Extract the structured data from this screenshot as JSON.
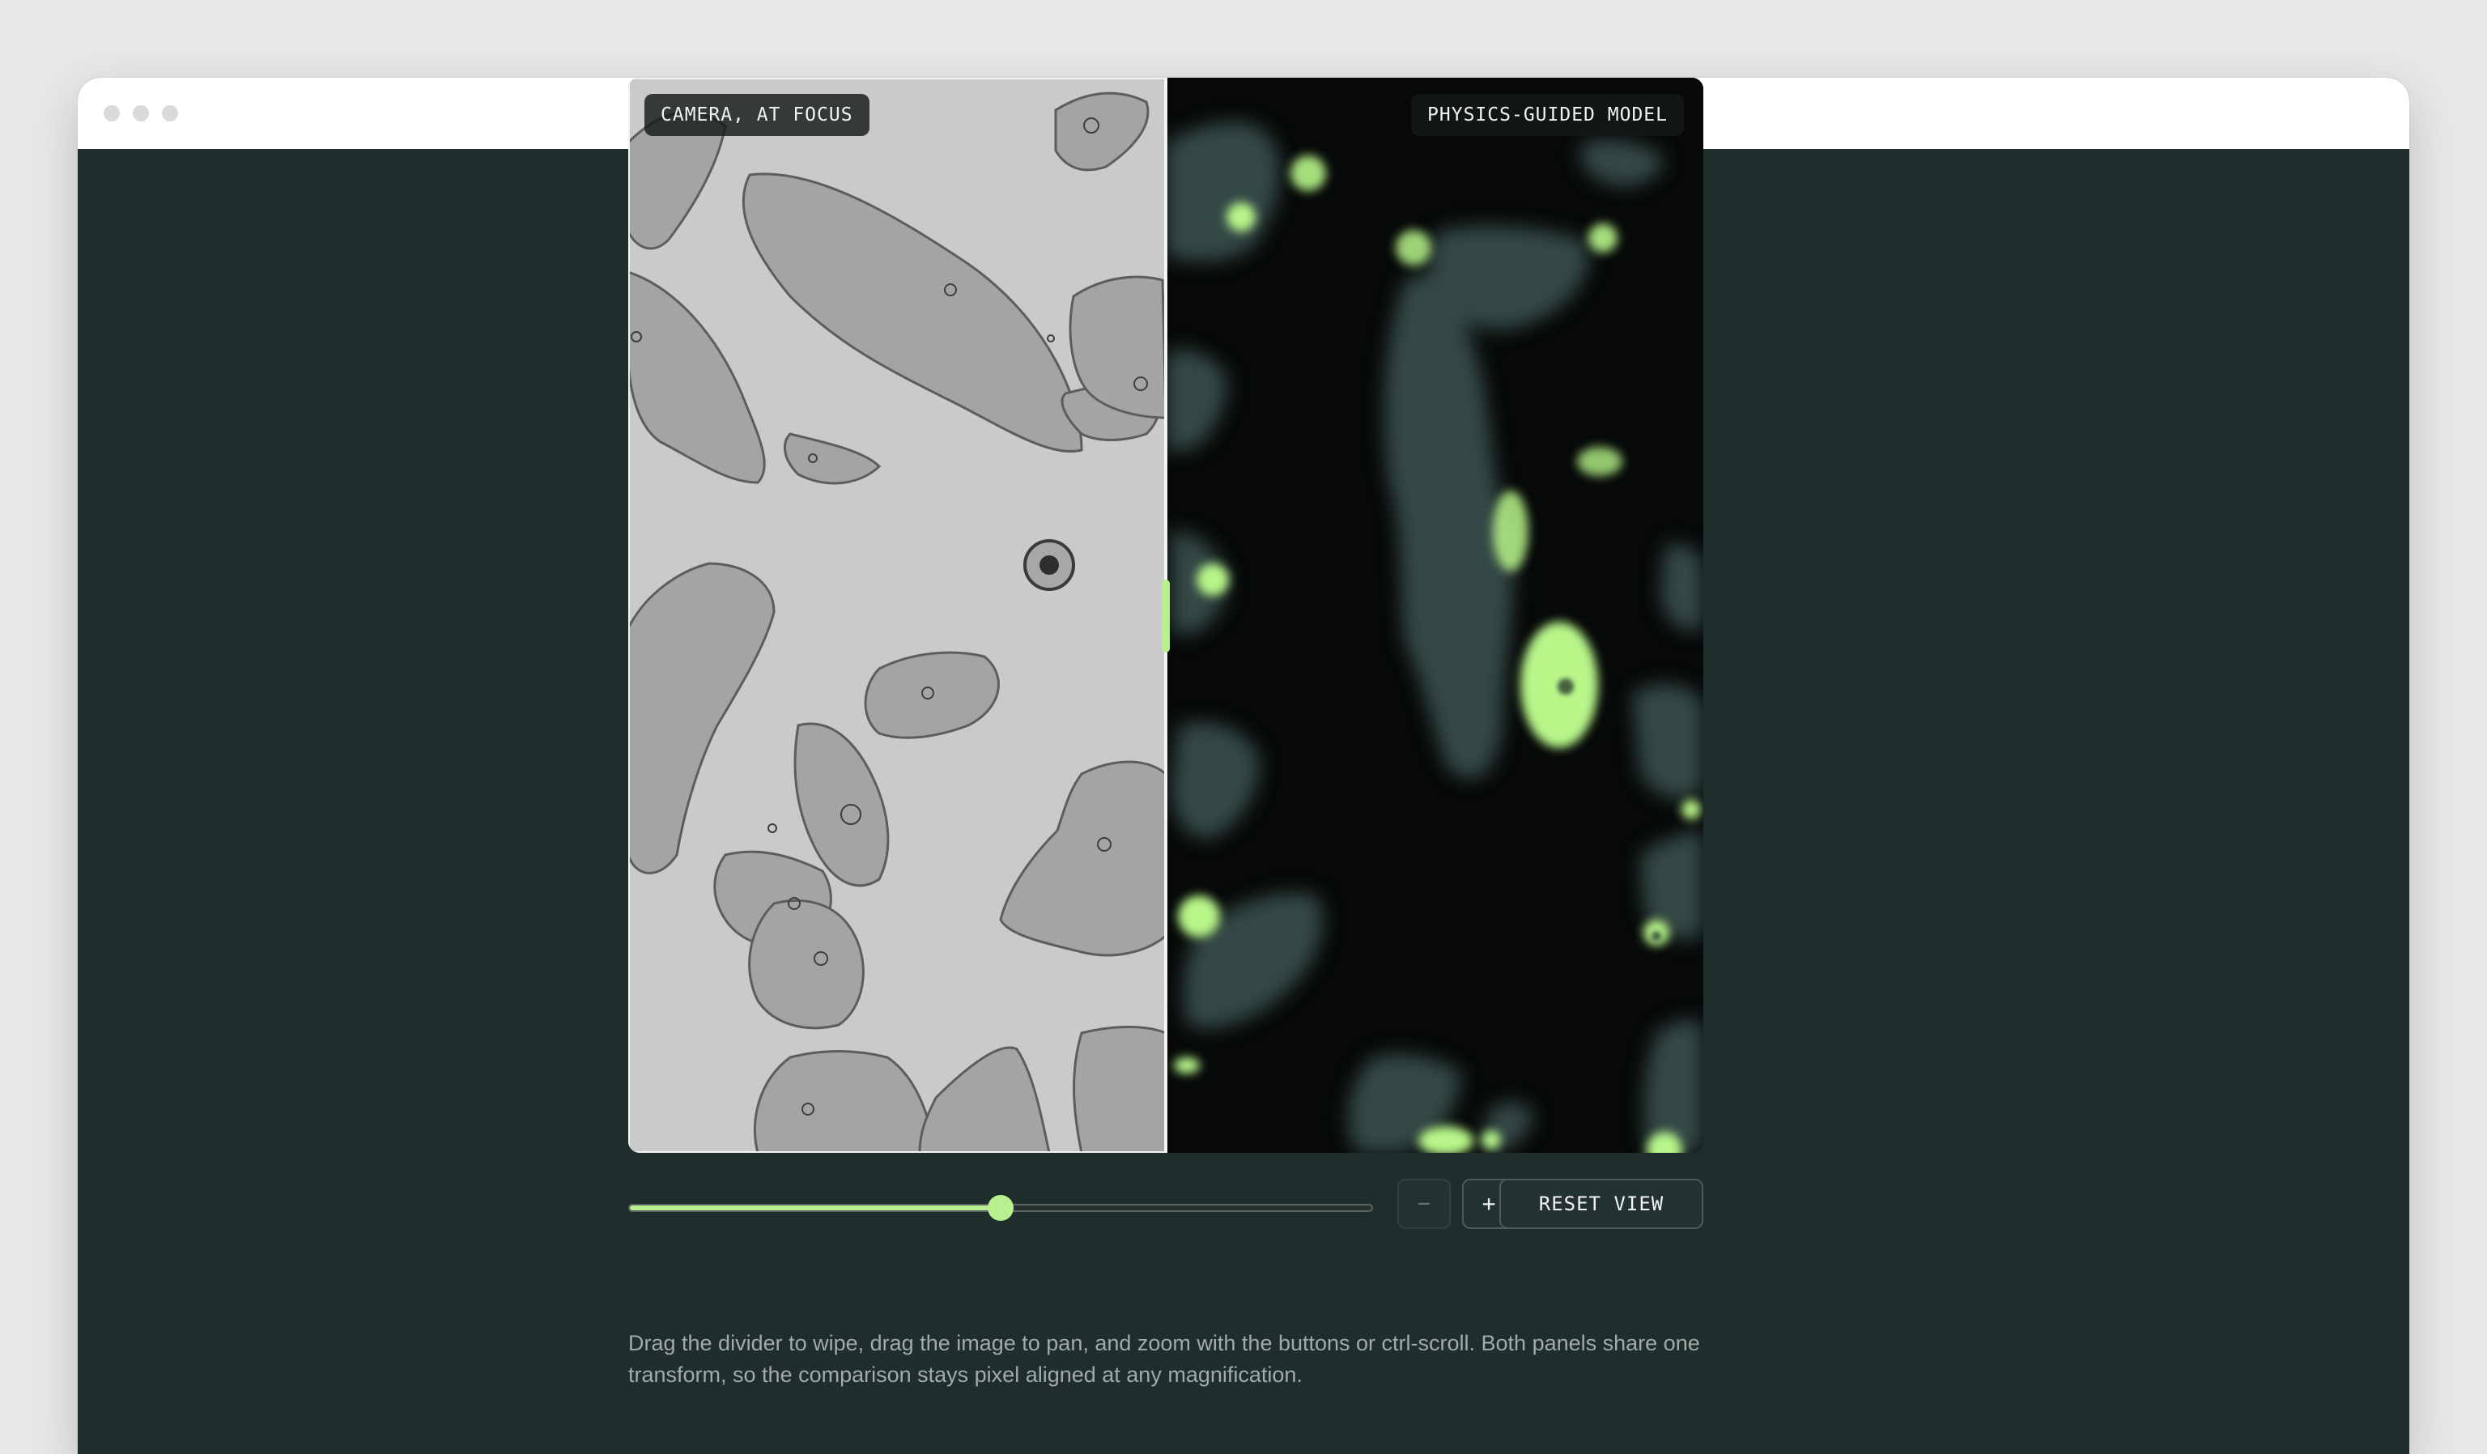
{
  "window": {
    "controls": [
      "close",
      "minimize",
      "maximize"
    ]
  },
  "viewer": {
    "left_label": "CAMERA, AT FOCUS",
    "right_label": "PHYSICS-GUIDED MODEL",
    "wipe_fraction": 0.5
  },
  "zoom": {
    "slider_fraction": 0.5,
    "zoom_out_label": "−",
    "zoom_in_label": "+",
    "reset_label": "RESET VIEW"
  },
  "caption": "Drag the divider to wipe, drag the image to pan, and zoom with the buttons or ctrl-scroll. Both panels share one transform, so the comparison stays pixel aligned at any magnification.",
  "colors": {
    "page_bg": "#1f2d2d",
    "accent": "#b9f08f",
    "brightfield_bg": "#c4c4c4",
    "fluorescence_bg": "#060908",
    "fluorescence_glow": "#b8f68a",
    "fluorescence_body": "#466261"
  }
}
